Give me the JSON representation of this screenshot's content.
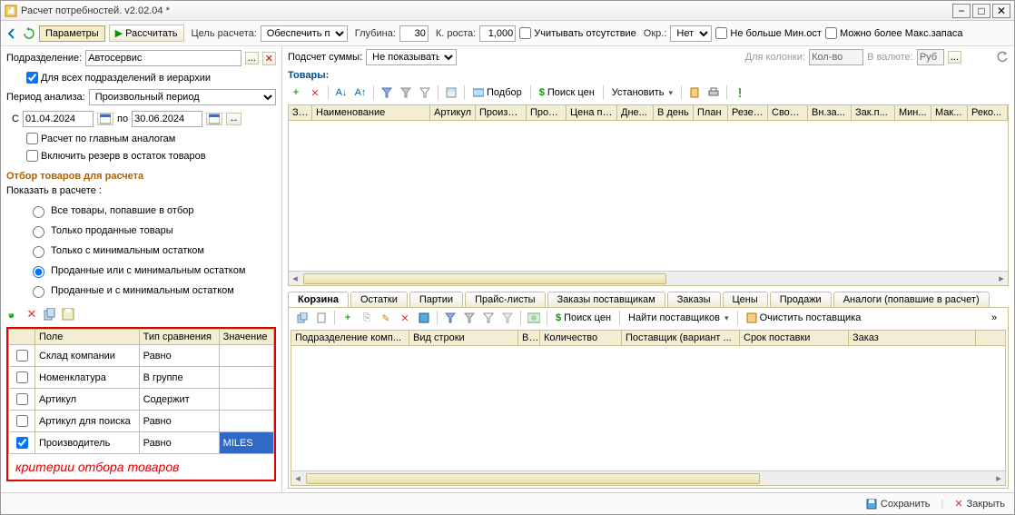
{
  "window": {
    "title": "Расчет потребностей. v2.02.04 *"
  },
  "toolbar": {
    "params_btn": "Параметры",
    "calc_btn": "Рассчитать",
    "goal_label": "Цель расчета:",
    "goal_value": "Обеспечить пла",
    "depth_label": "Глубина:",
    "depth_value": "30",
    "growth_label": "К. роста:",
    "growth_value": "1,000",
    "consider_absence": "Учитывать отсутствие",
    "round_label": "Окр.:",
    "round_value": "Нет о",
    "no_more_min": "Не больше Мин.ост",
    "can_more_max": "Можно более Макс.запаса"
  },
  "left": {
    "dept_label": "Подразделение:",
    "dept_value": "Автосервис",
    "all_depts": "Для всех подразделений в иерархии",
    "period_label": "Период анализа:",
    "period_value": "Произвольный период",
    "from_label": "С",
    "from_value": "01.04.2024",
    "to_label": "по",
    "to_value": "30.06.2024",
    "by_analogs": "Расчет по главным аналогам",
    "include_reserve": "Включить резерв в остаток товаров",
    "filter_title": "Отбор товаров для расчета",
    "show_label": "Показать в расчете :",
    "radios": [
      "Все товары, попавшие в отбор",
      "Только проданные товары",
      "Только с минимальным остатком",
      "Проданные или с минимальным остатком",
      "Проданные и с минимальным остатком"
    ],
    "radio_selected": 3,
    "filter_cols": [
      "Поле",
      "Тип сравнения",
      "Значение"
    ],
    "filter_rows": [
      {
        "checked": false,
        "field": "Склад компании",
        "cmp": "Равно",
        "val": ""
      },
      {
        "checked": false,
        "field": "Номенклатура",
        "cmp": "В группе",
        "val": ""
      },
      {
        "checked": false,
        "field": "Артикул",
        "cmp": "Содержит",
        "val": ""
      },
      {
        "checked": false,
        "field": "Артикул для поиска",
        "cmp": "Равно",
        "val": ""
      },
      {
        "checked": true,
        "field": "Производитель",
        "cmp": "Равно",
        "val": "MILES"
      }
    ],
    "annotation": "критерии отбора товаров"
  },
  "right_top": {
    "subtotal_label": "Подсчет суммы:",
    "subtotal_value": "Не показывать",
    "for_col_label": "Для колонки:",
    "for_col_value": "Кол-во",
    "currency_label": "В валюте:",
    "currency_value": "Руб",
    "goods_label": "Товары:"
  },
  "grid_buttons": {
    "podbor": "Подбор",
    "search_price": "Поиск цен",
    "set": "Установить"
  },
  "grid_cols": [
    "За...",
    "Наименование",
    "Артикул",
    "Произво...",
    "Прод...",
    "Цена пр...",
    "Дне...",
    "В день",
    "План",
    "Резерв",
    "Своб...",
    "Вн.за...",
    "Зак.п...",
    "Мин...",
    "Мак...",
    "Реко..."
  ],
  "tabs": [
    "Корзина",
    "Остатки",
    "Партии",
    "Прайс-листы",
    "Заказы поставщикам",
    "Заказы",
    "Цены",
    "Продажи",
    "Аналоги (попавшие в расчет)"
  ],
  "sub_toolbar": {
    "search_price": "Поиск цен",
    "find_suppliers": "Найти поставщиков",
    "clear_supplier": "Очистить поставщика"
  },
  "sub_cols": [
    "Подразделение комп...",
    "Вид строки",
    "В...",
    "Количество",
    "Поставщик (вариант ...",
    "Срок поставки",
    "Заказ"
  ],
  "footer": {
    "save": "Сохранить",
    "close": "Закрыть"
  }
}
